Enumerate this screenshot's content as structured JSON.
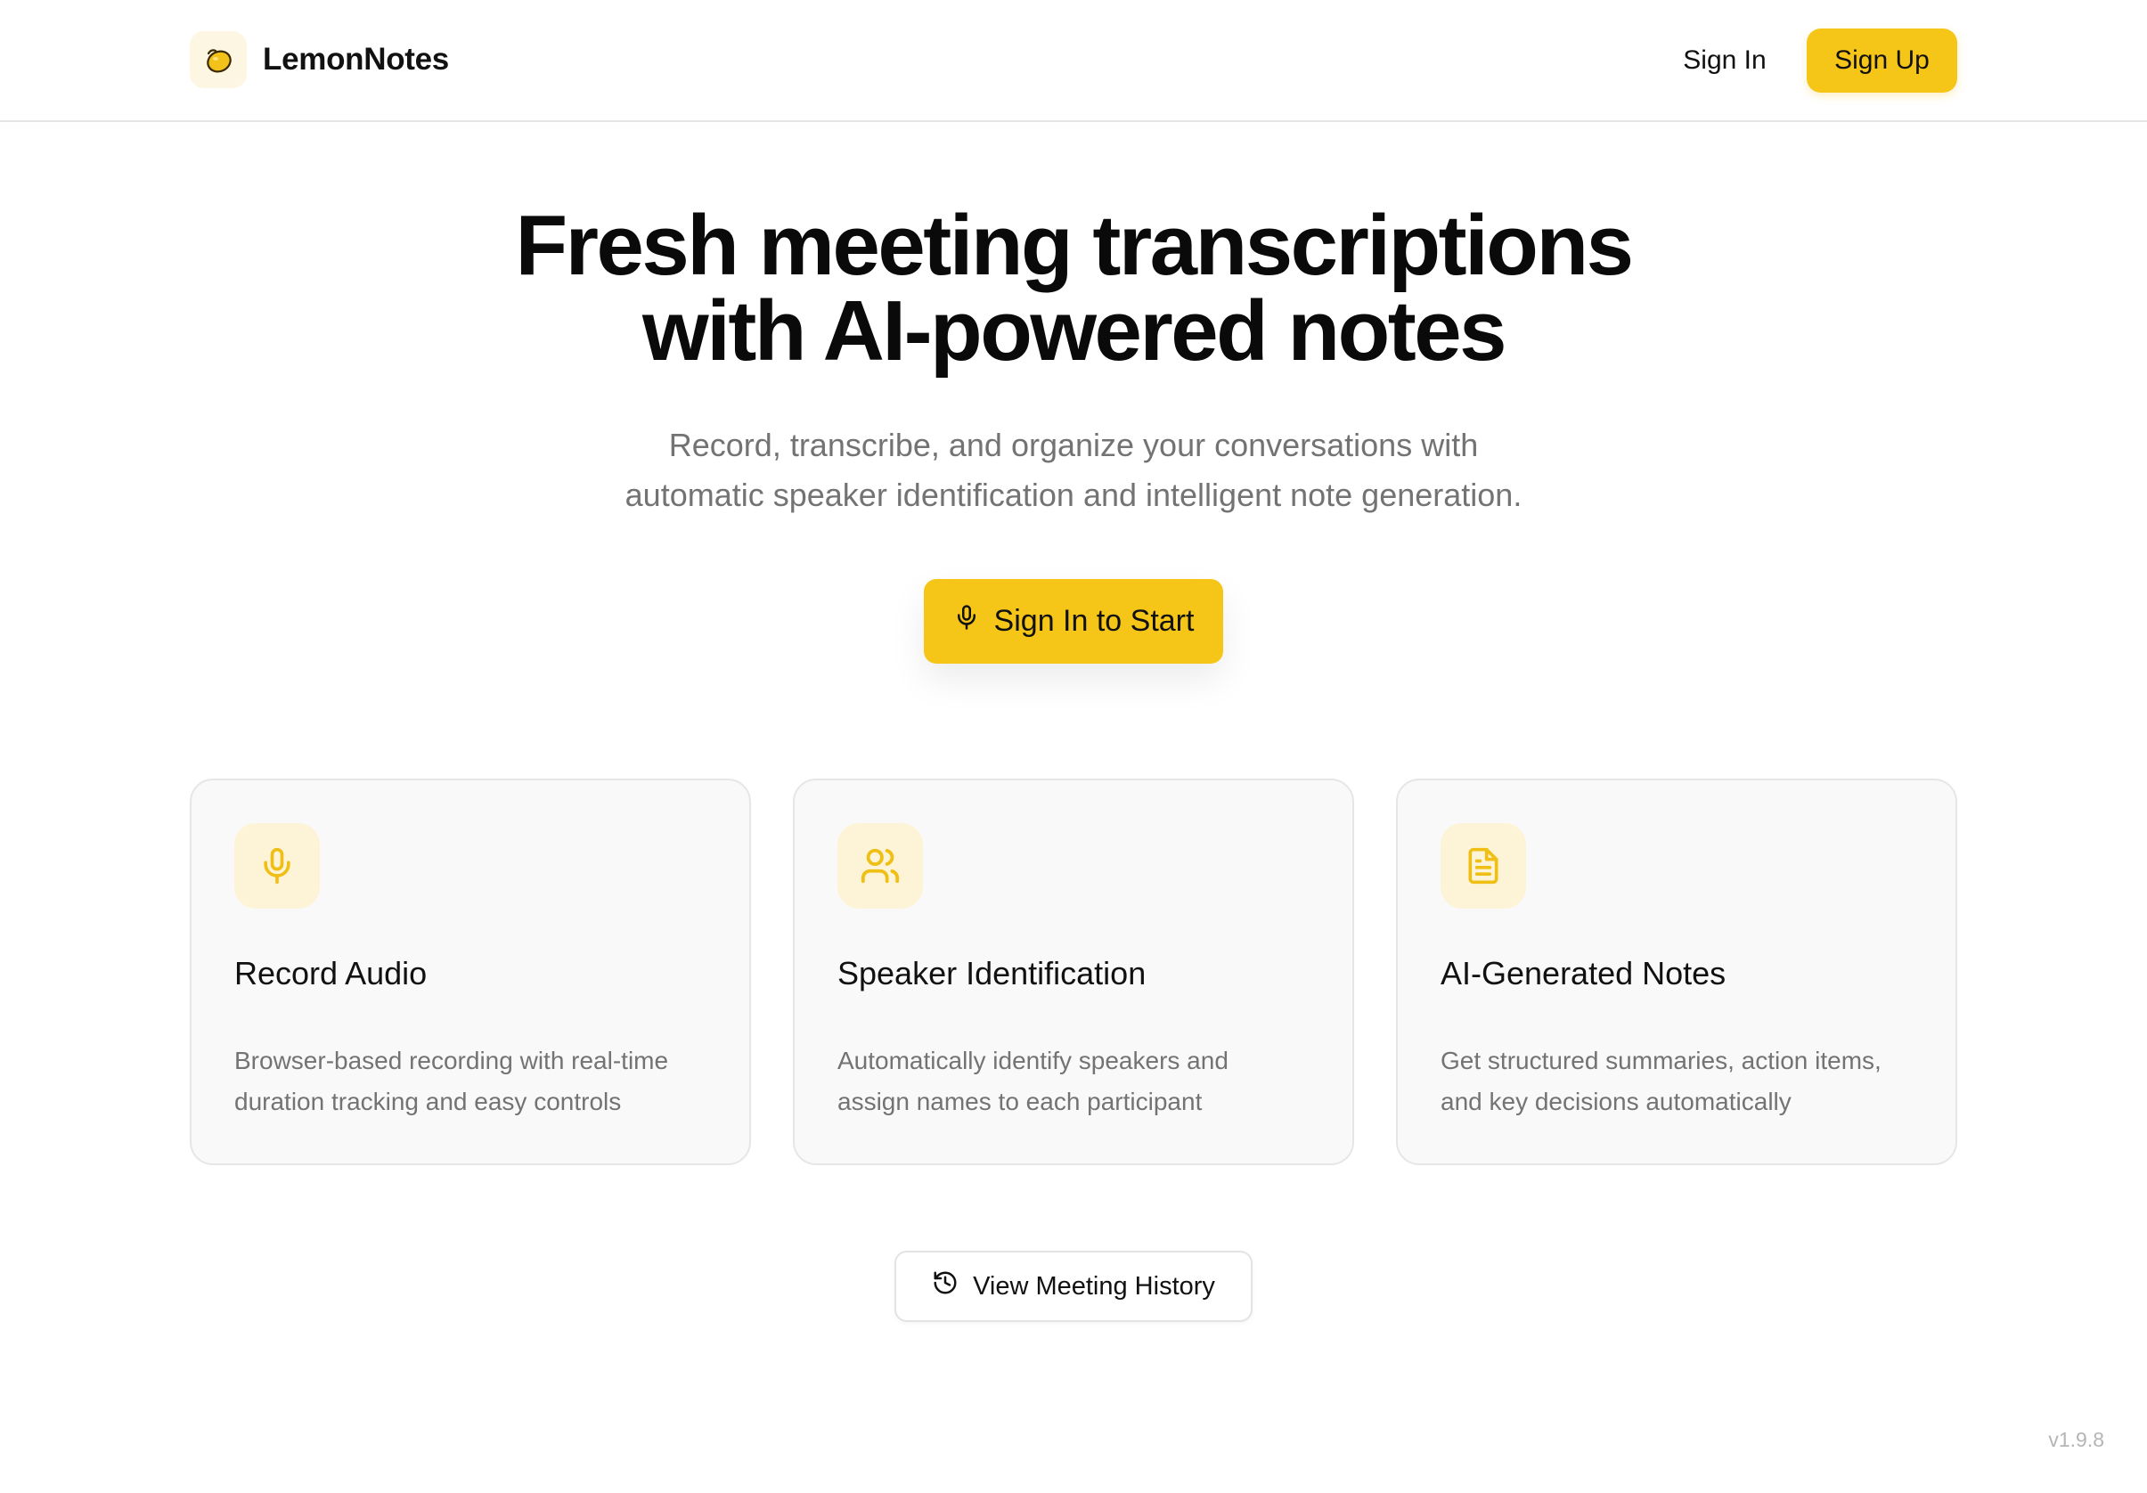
{
  "header": {
    "brand_name": "LemonNotes",
    "sign_in_label": "Sign In",
    "sign_up_label": "Sign Up"
  },
  "hero": {
    "title_line1": "Fresh meeting transcriptions",
    "title_line2": "with AI-powered notes",
    "subtitle_line1": "Record, transcribe, and organize your conversations with",
    "subtitle_line2": "automatic speaker identification and intelligent note generation.",
    "cta_label": "Sign In to Start",
    "cta_icon": "microphone-icon"
  },
  "features": [
    {
      "icon": "microphone-icon",
      "title": "Record Audio",
      "description_line1": "Browser-based recording with real-time",
      "description_line2": "duration tracking and easy controls"
    },
    {
      "icon": "users-icon",
      "title": "Speaker Identification",
      "description_line1": "Automatically identify speakers and",
      "description_line2": "assign names to each participant"
    },
    {
      "icon": "document-icon",
      "title": "AI-Generated Notes",
      "description_line1": "Get structured summaries, action items,",
      "description_line2": "and key decisions automatically"
    }
  ],
  "history": {
    "label": "View Meeting History",
    "icon": "history-icon"
  },
  "footer": {
    "version": "v1.9.8"
  },
  "colors": {
    "accent": "#f5c518",
    "icon_bg": "#fdf4d8",
    "muted_text": "#737373",
    "card_bg": "#f9f9f9"
  }
}
